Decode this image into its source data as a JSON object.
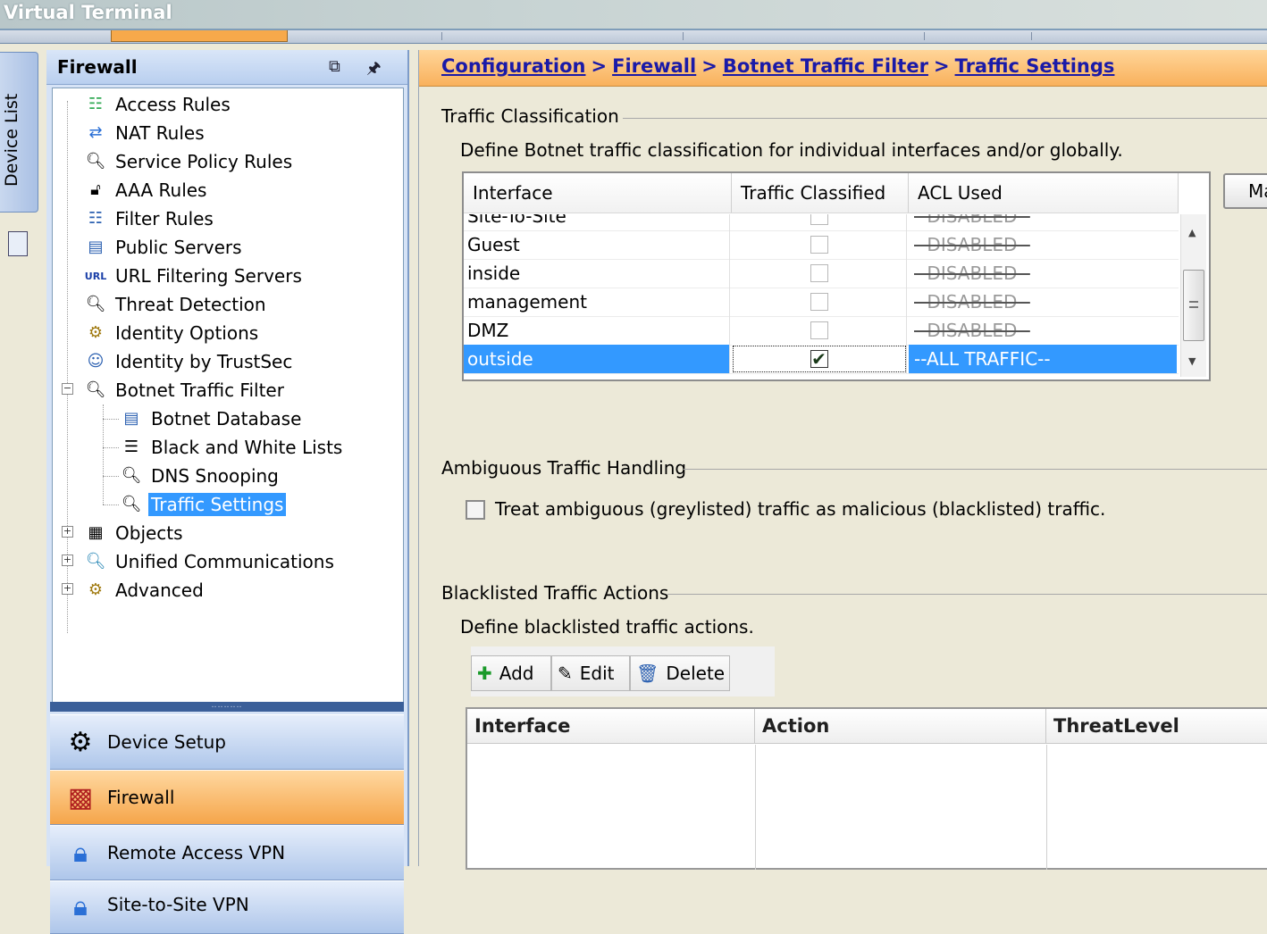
{
  "window": {
    "title": "Virtual Terminal"
  },
  "device_list": {
    "label": "Device List"
  },
  "nav": {
    "title": "Firewall",
    "header_buttons": [
      "restore-icon",
      "pin-icon"
    ],
    "tree": [
      {
        "label": "Access Rules",
        "icon": "access-rules-icon"
      },
      {
        "label": "NAT Rules",
        "icon": "nat-rules-icon"
      },
      {
        "label": "Service Policy Rules",
        "icon": "magnifier-icon"
      },
      {
        "label": "AAA Rules",
        "icon": "lock-icon"
      },
      {
        "label": "Filter Rules",
        "icon": "filter-icon"
      },
      {
        "label": "Public Servers",
        "icon": "server-icon"
      },
      {
        "label": "URL Filtering Servers",
        "icon": "url-icon"
      },
      {
        "label": "Threat Detection",
        "icon": "threat-icon"
      },
      {
        "label": "Identity Options",
        "icon": "identity-icon"
      },
      {
        "label": "Identity by TrustSec",
        "icon": "trustsec-icon"
      },
      {
        "label": "Botnet Traffic Filter",
        "icon": "botnet-icon",
        "expanded": true
      },
      {
        "label": "Botnet Database",
        "icon": "database-icon"
      },
      {
        "label": "Black and White Lists",
        "icon": "list-icon"
      },
      {
        "label": "DNS Snooping",
        "icon": "magnifier-icon"
      },
      {
        "label": "Traffic Settings",
        "icon": "magnifier-icon",
        "selected": true
      },
      {
        "label": "Objects",
        "icon": "objects-icon",
        "expanded": false
      },
      {
        "label": "Unified Communications",
        "icon": "uc-icon",
        "expanded": false
      },
      {
        "label": "Advanced",
        "icon": "advanced-icon",
        "expanded": false
      }
    ],
    "sections": [
      {
        "label": "Device Setup",
        "icon": "device-setup-icon"
      },
      {
        "label": "Firewall",
        "icon": "firewall-icon",
        "active": true
      },
      {
        "label": "Remote Access VPN",
        "icon": "remote-vpn-icon"
      },
      {
        "label": "Site-to-Site VPN",
        "icon": "site-vpn-icon"
      }
    ]
  },
  "breadcrumb": [
    "Configuration",
    "Firewall",
    "Botnet Traffic Filter",
    "Traffic Settings"
  ],
  "traffic_classification": {
    "title": "Traffic Classification",
    "description": "Define Botnet traffic classification for individual interfaces and/or globally.",
    "columns": [
      "Interface",
      "Traffic Classified",
      "ACL Used"
    ],
    "rows": [
      {
        "interface": "Site-To-Site",
        "classified": false,
        "acl": "--DISABLED--"
      },
      {
        "interface": "Guest",
        "classified": false,
        "acl": "--DISABLED--"
      },
      {
        "interface": "inside",
        "classified": false,
        "acl": "--DISABLED--"
      },
      {
        "interface": "management",
        "classified": false,
        "acl": "--DISABLED--"
      },
      {
        "interface": "DMZ",
        "classified": false,
        "acl": "--DISABLED--"
      },
      {
        "interface": "outside",
        "classified": true,
        "acl": "--ALL TRAFFIC--",
        "selected": true
      }
    ],
    "side_button": "Ma"
  },
  "ambiguous": {
    "title": "Ambiguous Traffic Handling",
    "checkbox_label": "Treat ambiguous (greylisted) traffic as malicious (blacklisted) traffic.",
    "checked": false
  },
  "blacklisted": {
    "title": "Blacklisted Traffic Actions",
    "description": "Define blacklisted traffic actions.",
    "buttons": [
      {
        "label": "Add",
        "icon": "plus-icon"
      },
      {
        "label": "Edit",
        "icon": "edit-icon"
      },
      {
        "label": "Delete",
        "icon": "trash-icon"
      }
    ],
    "columns": [
      "Interface",
      "Action",
      "ThreatLevel"
    ],
    "rows": []
  },
  "colors": {
    "selection": "#3399ff",
    "active_orange": "#f5a54a",
    "link": "#1a1aa8"
  }
}
